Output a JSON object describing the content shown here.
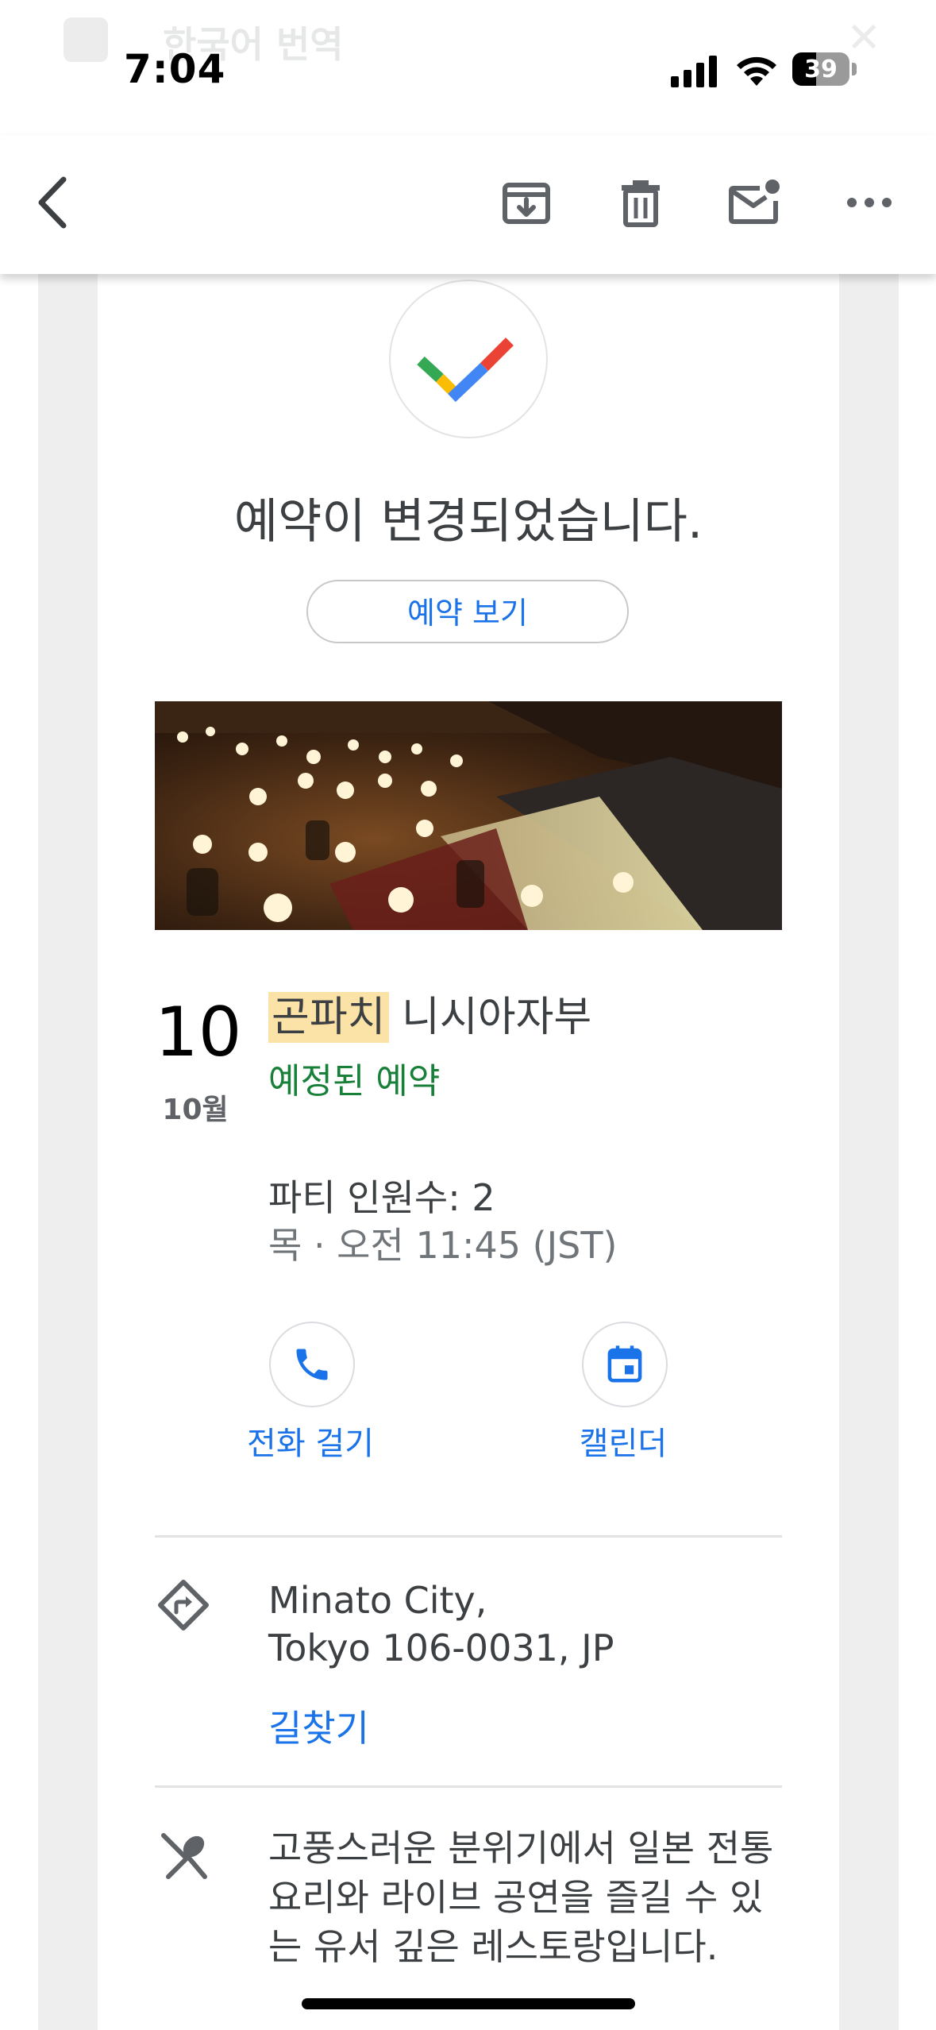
{
  "status_bar": {
    "time": "7:04",
    "battery": "39",
    "ghost_banner_text": "한국어 번역",
    "icons": [
      "signal-icon",
      "wifi-icon",
      "battery-icon"
    ]
  },
  "toolbar": {
    "icons": [
      "back-icon",
      "archive-icon",
      "delete-icon",
      "mark-unread-icon",
      "more-icon"
    ]
  },
  "confirmation": {
    "headline": "예약이 변경되었습니다.",
    "view_button": "예약 보기"
  },
  "reservation": {
    "day": "10",
    "month": "10월",
    "name_highlighted": "곤파치",
    "name_rest": " 니시아자부",
    "status": "예정된 예약",
    "party_size": "파티 인원수: 2",
    "datetime": "목 · 오전 11:45 (JST)"
  },
  "actions": {
    "call": "전화 걸기",
    "calendar": "캘린더"
  },
  "address": {
    "line1": "Minato City,",
    "line2": "Tokyo 106-0031, JP",
    "directions": "길찾기"
  },
  "description": "고풍스러운 분위기에서 일본 전통 요리와 라이브 공연을 즐길 수 있는 유서 깊은 레스토랑입니다.",
  "colors": {
    "link_blue": "#1a73e8",
    "status_green": "#188038",
    "highlight": "#fbe2a6",
    "text_dark": "#3c4043"
  }
}
